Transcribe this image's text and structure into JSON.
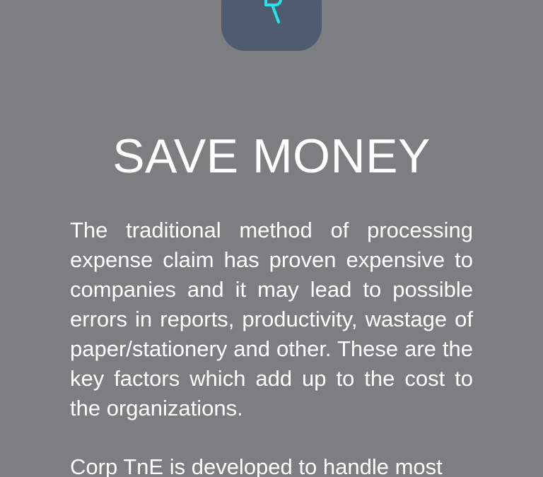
{
  "hero": {
    "title": "SAVE MONEY",
    "paragraphs": [
      "The traditional method of processing expense claim has proven expensive to companies and it may lead to possible errors in reports, productivity, wastage of paper/stationery and other. These are the key factors which add up to the cost to the organizations.",
      "Corp TnE is developed to handle most"
    ]
  },
  "colors": {
    "background": "#7d7e80",
    "logo_badge": "#4f5c6f",
    "logo_accent": "#26e3ee",
    "text": "#ffffff"
  },
  "icons": {
    "logo": "brand-logo-icon"
  }
}
